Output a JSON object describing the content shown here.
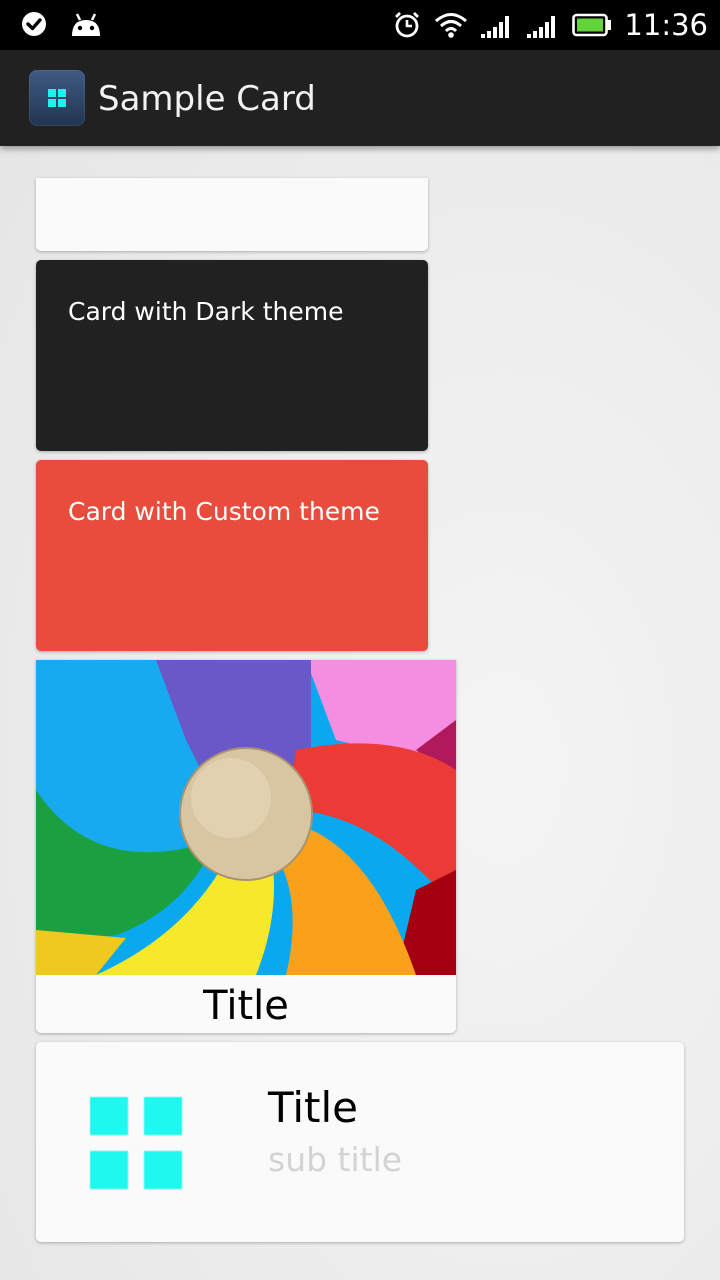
{
  "status_bar": {
    "time": "11:36",
    "left_icons": [
      "check-circle-icon",
      "android-icon"
    ],
    "right_icons": [
      "alarm-icon",
      "wifi-icon",
      "signal-icon",
      "signal-icon",
      "battery-icon"
    ]
  },
  "action_bar": {
    "title": "Sample Card",
    "icon": "app-grid-icon"
  },
  "cards": {
    "dark": {
      "text": "Card with Dark theme",
      "background": "#212121"
    },
    "custom": {
      "text": "Card with Custom theme",
      "background": "#E84C3D"
    },
    "image": {
      "title": "Title",
      "image": "rainbow-pinwheel-image"
    },
    "list": {
      "title": "Title",
      "subtitle": "sub title",
      "icon": "grid-icon",
      "accent": "#1FF8EE"
    }
  }
}
